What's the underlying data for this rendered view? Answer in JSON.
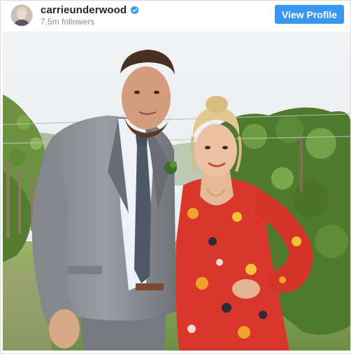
{
  "profile": {
    "username": "carrieunderwood",
    "followers": "7.5m followers",
    "verified": true,
    "avatar_icon": "profile-photo-avatar"
  },
  "actions": {
    "view_profile_label": "View Profile"
  },
  "colors": {
    "button_blue": "#3897f0",
    "verified_blue": "#3897f0",
    "username_text": "#262626",
    "secondary_text": "#8e8e8e",
    "border": "#dbdbdb"
  },
  "post": {
    "image_description_icon": "post-photo"
  }
}
